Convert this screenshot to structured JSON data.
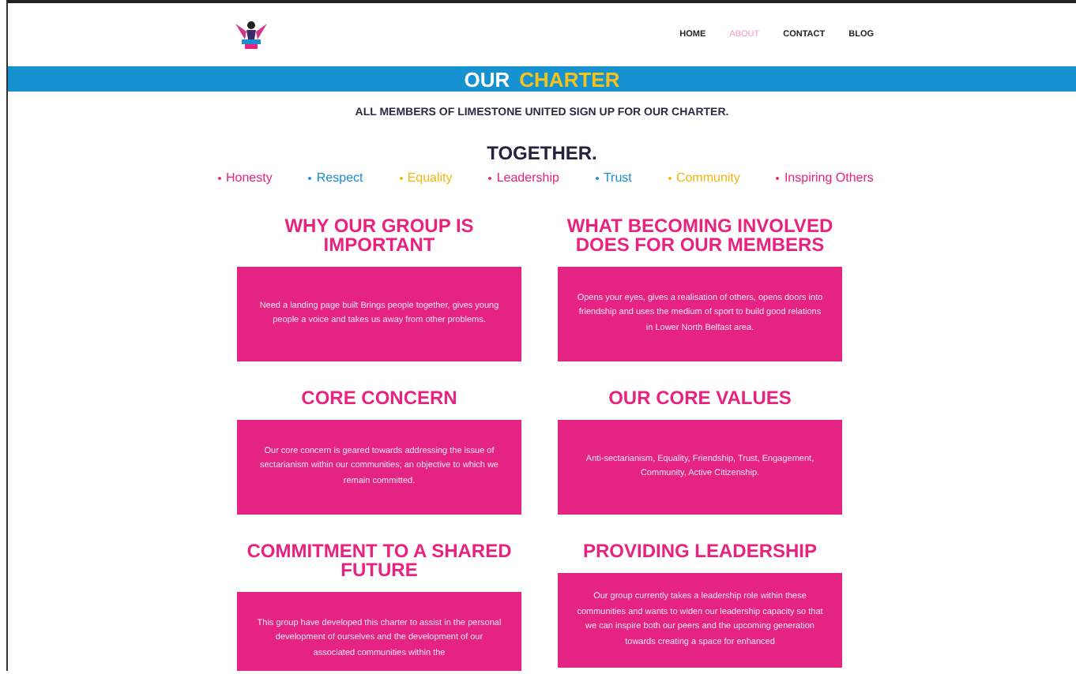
{
  "nav": [
    {
      "label": "HOME",
      "selected": false
    },
    {
      "label": "ABOUT",
      "selected": true
    },
    {
      "label": "CONTACT",
      "selected": false
    },
    {
      "label": "BLOG",
      "selected": false
    }
  ],
  "banner": {
    "title_plain": "OUR",
    "title_accent": "CHARTER"
  },
  "intro": "ALL MEMBERS OF LIMESTONE UNITED SIGN UP FOR OUR CHARTER.",
  "together": "TOGETHER.",
  "values": [
    {
      "label": "Honesty",
      "color": "#e8237f"
    },
    {
      "label": "Respect",
      "color": "#1b8fd0"
    },
    {
      "label": "Equality",
      "color": "#f2b70f"
    },
    {
      "label": "Leadership",
      "color": "#e8237f"
    },
    {
      "label": "Trust",
      "color": "#1b8fd0"
    },
    {
      "label": "Community",
      "color": "#f2b70f"
    },
    {
      "label": "Inspiring Others",
      "color": "#e8237f"
    }
  ],
  "sections": [
    {
      "heading": "WHY OUR GROUP IS IMPORTANT",
      "text": "Need a landing page built Brings people together, gives young people a voice and takes us away from other problems."
    },
    {
      "heading": "WHAT BECOMING INVOLVED DOES FOR OUR MEMBERS",
      "text": "Opens your eyes, gives a realisation of others, opens doors into friendship and uses the medium of sport to build good relations in Lower North Belfast area."
    },
    {
      "heading": "CORE CONCERN",
      "text": "Our core concern is geared towards addressing the issue of sectarianism within our communities; an objective to which we remain committed."
    },
    {
      "heading": "OUR CORE VALUES",
      "text": "Anti-sectarianism, Equality, Friendship, Trust, Engagement, Community, Active Citizenship."
    },
    {
      "heading": "COMMITMENT TO A SHARED FUTURE",
      "text": "This group have developed this charter to assist in the personal development of ourselves and the development of our associated communities within the"
    },
    {
      "heading": "PROVIDING LEADERSHIP",
      "text": "Our group currently takes a leadership role within these communities and wants to widen our leadership capacity so that we can inspire both our peers and the upcoming generation towards creating a space for enhanced"
    }
  ]
}
